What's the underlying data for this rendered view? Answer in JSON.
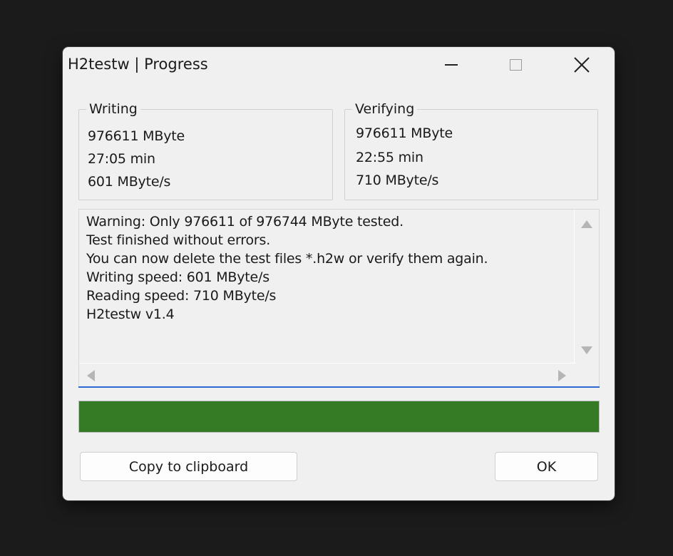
{
  "window": {
    "title": "H2testw | Progress"
  },
  "writing": {
    "label": "Writing",
    "size": "976611 MByte",
    "time": "27:05 min",
    "speed": "601 MByte/s"
  },
  "verifying": {
    "label": "Verifying",
    "size": "976611 MByte",
    "time": "22:55 min",
    "speed": "710 MByte/s"
  },
  "log": {
    "lines": [
      "Warning: Only 976611 of 976744 MByte tested.",
      "Test finished without errors.",
      "You can now delete the test files *.h2w or verify them again.",
      "Writing speed: 601 MByte/s",
      "Reading speed: 710 MByte/s",
      "H2testw v1.4"
    ]
  },
  "progress": {
    "percent": 100,
    "color": "#357a25"
  },
  "buttons": {
    "copy_label": "Copy to clipboard",
    "ok_label": "OK"
  },
  "icons": {
    "minimize": "minimize-icon",
    "maximize": "maximize-icon",
    "close": "close-icon"
  }
}
